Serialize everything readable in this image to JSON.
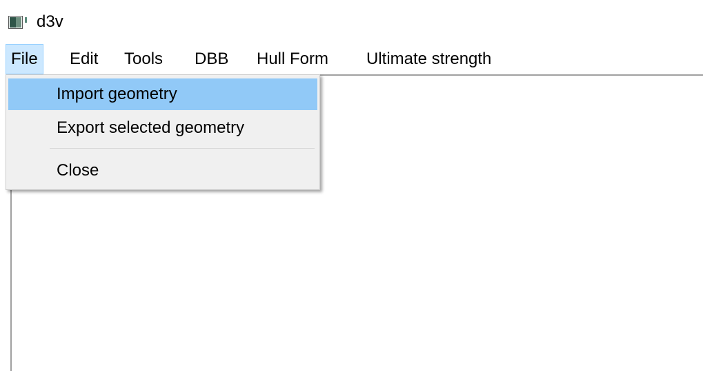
{
  "window": {
    "title": "d3v",
    "icon": "app-window-icon"
  },
  "menubar": {
    "items": [
      {
        "label": "File",
        "active": true
      },
      {
        "label": "Edit"
      },
      {
        "label": "Tools"
      },
      {
        "label": "DBB"
      },
      {
        "label": "Hull Form"
      },
      {
        "label": "Ultimate strength"
      }
    ]
  },
  "file_menu": {
    "items": [
      {
        "label": "Import geometry",
        "highlighted": true
      },
      {
        "label": "Export selected geometry"
      },
      {
        "label": "Close"
      }
    ]
  },
  "colors": {
    "menu_active_bg": "#cce8ff",
    "menu_item_highlight": "#91c9f7",
    "dropdown_bg": "#f0f0f0"
  }
}
